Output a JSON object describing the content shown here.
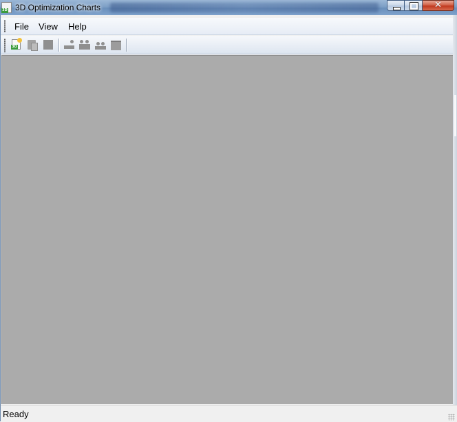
{
  "window": {
    "title": "3D Optimization Charts",
    "app_icon_badge": "3D",
    "caption_buttons": [
      {
        "name": "minimize-button",
        "glyph": ""
      },
      {
        "name": "maximize-button",
        "glyph": ""
      },
      {
        "name": "close-button",
        "glyph": "✕"
      }
    ]
  },
  "menu": {
    "items": [
      "File",
      "View",
      "Help"
    ]
  },
  "toolbar": {
    "new_badge": "3D",
    "buttons": [
      {
        "icon": "new-chart-icon",
        "enabled": true
      },
      {
        "icon": "paste-icon",
        "enabled": false
      },
      {
        "icon": "stop-icon",
        "enabled": false
      },
      {
        "icon": "single-user-icon",
        "enabled": false
      },
      {
        "icon": "two-users-icon",
        "enabled": false
      },
      {
        "icon": "users-group-icon",
        "enabled": false
      },
      {
        "icon": "panel-icon",
        "enabled": false
      }
    ]
  },
  "status": {
    "text": "Ready"
  },
  "colors": {
    "workspace": "#ababab",
    "chrome": "#f0f0f0",
    "title_bar": "#7d9fc6",
    "close_button": "#c0391f"
  }
}
